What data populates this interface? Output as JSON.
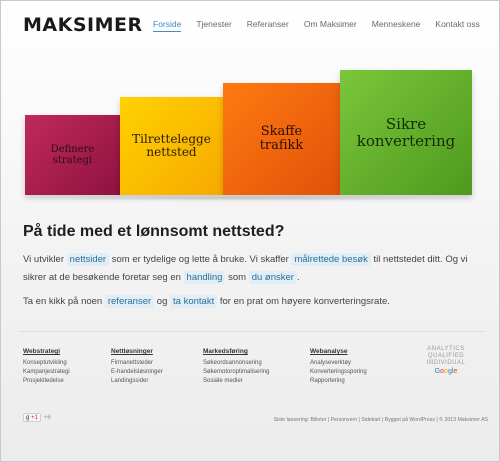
{
  "brand": {
    "logo_text": "MAKSIMER"
  },
  "nav": [
    {
      "label": "Forside",
      "active": true
    },
    {
      "label": "Tjenester"
    },
    {
      "label": "Referanser"
    },
    {
      "label": "Om Maksimer"
    },
    {
      "label": "Menneskene"
    },
    {
      "label": "Kontakt oss"
    }
  ],
  "stairs": [
    {
      "line1": "Definere",
      "line2": "strategi",
      "color": "#b11f4f"
    },
    {
      "line1": "Tilrettelegge",
      "line2": "nettsted",
      "color": "#f9bd00"
    },
    {
      "line1": "Skaffe",
      "line2": "trafikk",
      "color": "#f46a0f"
    },
    {
      "line1": "Sikre",
      "line2": "konvertering",
      "color": "#66b12d"
    }
  ],
  "intro": {
    "heading": "På tide med et lønnsomt nettsted?",
    "p1": {
      "t1": "Vi utvikler ",
      "link1": "nettsider",
      "t2": " som er tydelige og lette å bruke. Vi skaffer ",
      "link2": "målrettede besøk",
      "t3": " til nettstedet ditt. Og vi sikrer at de besøkende foretar seg en ",
      "link3": "handling",
      "t4": " som ",
      "link4": "du ønsker",
      "t5": "."
    },
    "p2": {
      "t1": "Ta en kikk på noen ",
      "link1": "referanser",
      "t2": " og ",
      "link2": "ta kontakt",
      "t3": " for en prat om høyere konverteringsrate."
    }
  },
  "footer": {
    "columns": [
      {
        "title": "Webstrategi",
        "items": [
          "Konseptutvikling",
          "Kampanjestrategi",
          "Prosjektledelse"
        ]
      },
      {
        "title": "Nettløsninger",
        "items": [
          "Firmanettsteder",
          "E-handelsløsninger",
          "Landingssider"
        ]
      },
      {
        "title": "Markedsføring",
        "items": [
          "Søkeordsannonsering",
          "Søkemotoroptimalisering",
          "Sosiale medier"
        ]
      },
      {
        "title": "Webanalyse",
        "items": [
          "Analyseverktøy",
          "Konverteringssporing",
          "Rapportering"
        ]
      }
    ],
    "badge": {
      "line1": "ANALYTICS",
      "line2": "QUALIFIED",
      "line3": "INDIVIDUAL",
      "google": [
        "G",
        "o",
        "o",
        "g",
        "l",
        "e"
      ]
    },
    "gplus": {
      "label": "+1",
      "count": "+6"
    },
    "copyright": "Siste lansering: Billoter | Personvern | Sidekart | Bygget på WordPress | © 2013 Maksimer AS"
  }
}
